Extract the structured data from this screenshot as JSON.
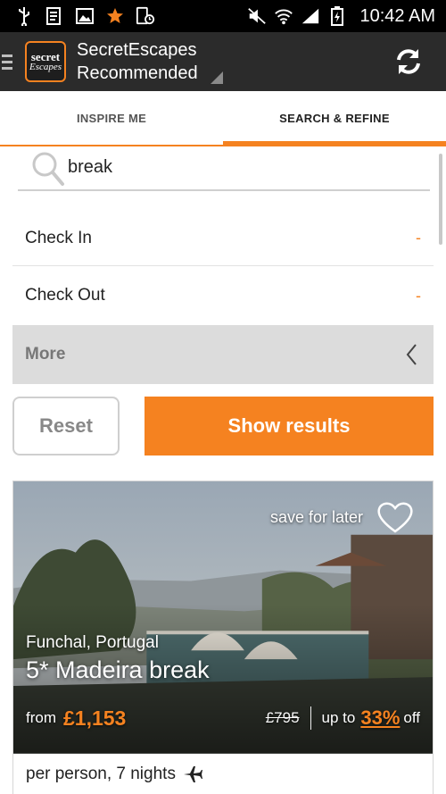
{
  "status_bar": {
    "time": "10:42 AM",
    "icons": [
      "usb-icon",
      "sim-icon",
      "image-icon",
      "star-icon",
      "phone-clock-icon",
      "mute-icon",
      "wifi-icon",
      "signal-icon",
      "battery-icon"
    ]
  },
  "action_bar": {
    "logo_line1": "secret",
    "logo_line2": "Escapes",
    "title": "SecretEscapes",
    "subtitle": "Recommended"
  },
  "tabs": [
    {
      "label": "INSPIRE ME",
      "active": false
    },
    {
      "label": "SEARCH & REFINE",
      "active": true
    }
  ],
  "search": {
    "value": "break"
  },
  "filters": {
    "check_in": {
      "label": "Check In",
      "value": "-"
    },
    "check_out": {
      "label": "Check Out",
      "value": "-"
    },
    "more": {
      "label": "More"
    }
  },
  "buttons": {
    "reset": "Reset",
    "show_results": "Show results"
  },
  "deal": {
    "save_later": "save for later",
    "location": "Funchal, Portugal",
    "title": "5* Madeira break",
    "from_label": "from",
    "price": "£1,153",
    "old_price": "£795",
    "up_to_label": "up to",
    "discount": "33%",
    "off_label": "off",
    "footer": "per person, 7 nights"
  },
  "colors": {
    "accent": "#f58220",
    "action_bar": "#2b2b2b",
    "status_bar": "#000000"
  }
}
